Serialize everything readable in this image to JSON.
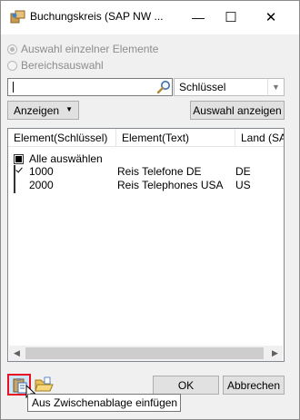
{
  "window": {
    "title": "Buchungskreis (SAP NW ...",
    "minimize_glyph": "—",
    "maximize_glyph": "☐",
    "close_glyph": "✕"
  },
  "radios": {
    "single": "Auswahl einzelner Elemente",
    "range": "Bereichsauswahl",
    "selected": "single"
  },
  "search": {
    "value": "",
    "field_select": "Schlüssel"
  },
  "toolbar": {
    "show_menu": "Anzeigen",
    "show_selection": "Auswahl anzeigen"
  },
  "list": {
    "columns": [
      "Element(Schlüssel)",
      "Element(Text)",
      "Land (SAP"
    ],
    "select_all": "Alle auswählen",
    "rows": [
      {
        "key": "1000",
        "text": "Reis Telefone DE",
        "country": "DE",
        "checked": true
      },
      {
        "key": "2000",
        "text": "Reis Telephones USA",
        "country": "US",
        "checked": false
      }
    ]
  },
  "footer": {
    "ok": "OK",
    "cancel": "Abbrechen",
    "tooltip": "Aus Zwischenablage einfügen"
  },
  "colors": {
    "highlight": "#e81123",
    "disabled_text": "#8d8d8d"
  },
  "icons": [
    "app-icon",
    "search-icon",
    "paste-from-clipboard-icon",
    "open-folder-icon"
  ]
}
